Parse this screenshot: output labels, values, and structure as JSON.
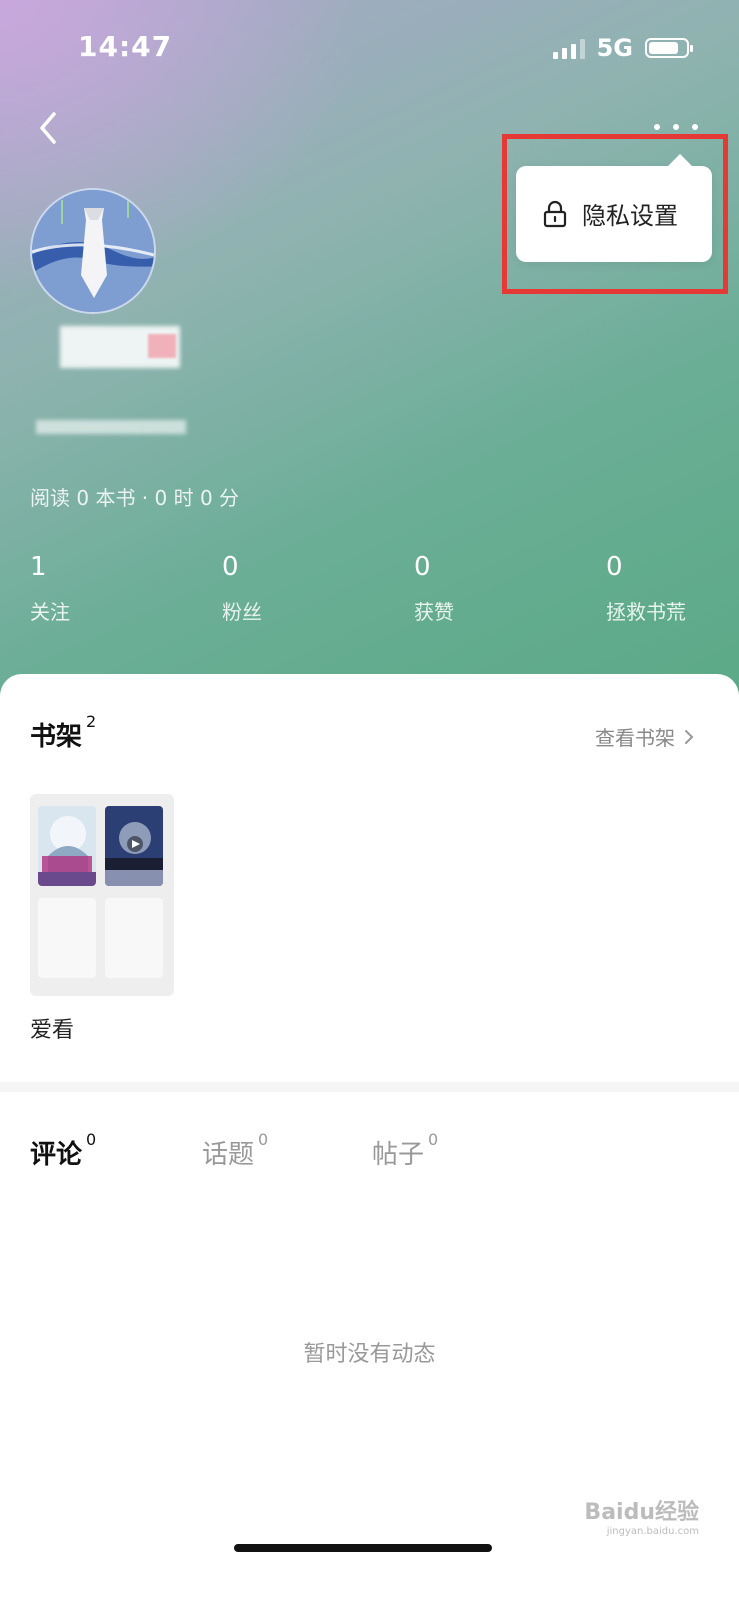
{
  "status_bar": {
    "time": "14:47",
    "network": "5G"
  },
  "profile": {
    "reading_summary": "阅读 0 本书 · 0 时 0 分"
  },
  "stats": [
    {
      "value": "1",
      "label": "关注"
    },
    {
      "value": "0",
      "label": "粉丝"
    },
    {
      "value": "0",
      "label": "获赞"
    },
    {
      "value": "0",
      "label": "拯救书荒"
    }
  ],
  "popup_menu": {
    "item_label": "隐私设置"
  },
  "bookshelf": {
    "title": "书架",
    "count": "2",
    "view_all": "查看书架",
    "shelf_name": "爱看"
  },
  "tabs": [
    {
      "label": "评论",
      "count": "0"
    },
    {
      "label": "话题",
      "count": "0"
    },
    {
      "label": "帖子",
      "count": "0"
    }
  ],
  "activity": {
    "empty_text": "暂时没有动态"
  },
  "watermark": {
    "brand": "Baidu经验",
    "url": "jingyan.baidu.com"
  },
  "colors": {
    "highlight": "#e53935",
    "hero_green": "#5aa985",
    "hero_purple": "#c9a8dd"
  },
  "icons": {
    "back": "chevron-left-icon",
    "more": "more-dots-icon",
    "lock": "lock-icon",
    "arrow": "chevron-right-icon"
  }
}
